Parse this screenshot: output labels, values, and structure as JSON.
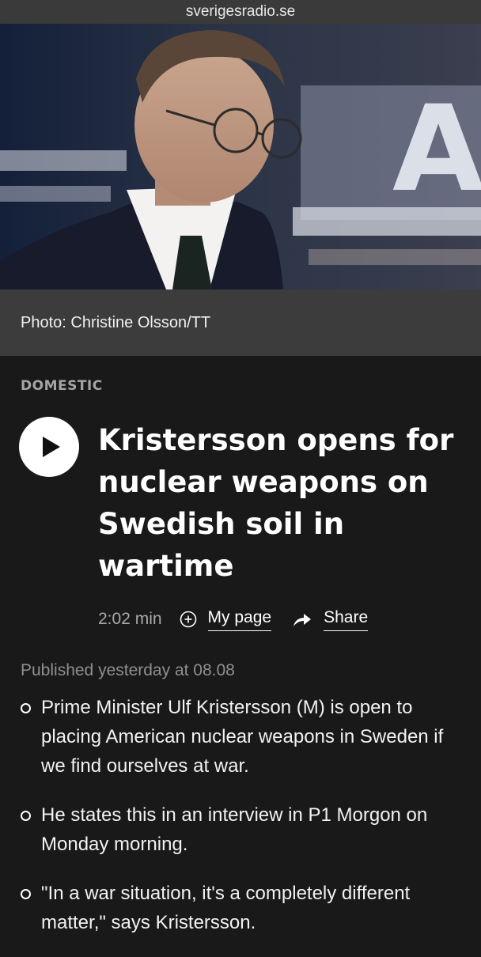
{
  "browser": {
    "domain": "sverigesradio.se"
  },
  "article": {
    "photo_caption": "Photo: Christine Olsson/TT",
    "category": "DOMESTIC",
    "title": "Kristersson opens for nuclear weapons on Swedish soil in wartime",
    "duration": "2:02 min",
    "my_page_label": "My page",
    "share_label": "Share",
    "published": "Published yesterday at 08.08",
    "bullets": [
      "Prime Minister Ulf Kristersson (M) is open to placing American nuclear weapons in Sweden if we find ourselves at war.",
      "He states this in an interview in P1 Morgon on Monday morning.",
      "\"In a war situation, it's a completely different matter,\" says Kristersson."
    ]
  },
  "icons": {
    "play": "play-icon",
    "add": "plus-circle-icon",
    "share": "share-arrow-icon",
    "bullet": "hollow-circle-bullet-icon"
  },
  "colors": {
    "background": "#191919",
    "caption_bar": "#3c3c3c",
    "category_text": "#a5a5a5",
    "muted_text": "#8f8f8f"
  }
}
